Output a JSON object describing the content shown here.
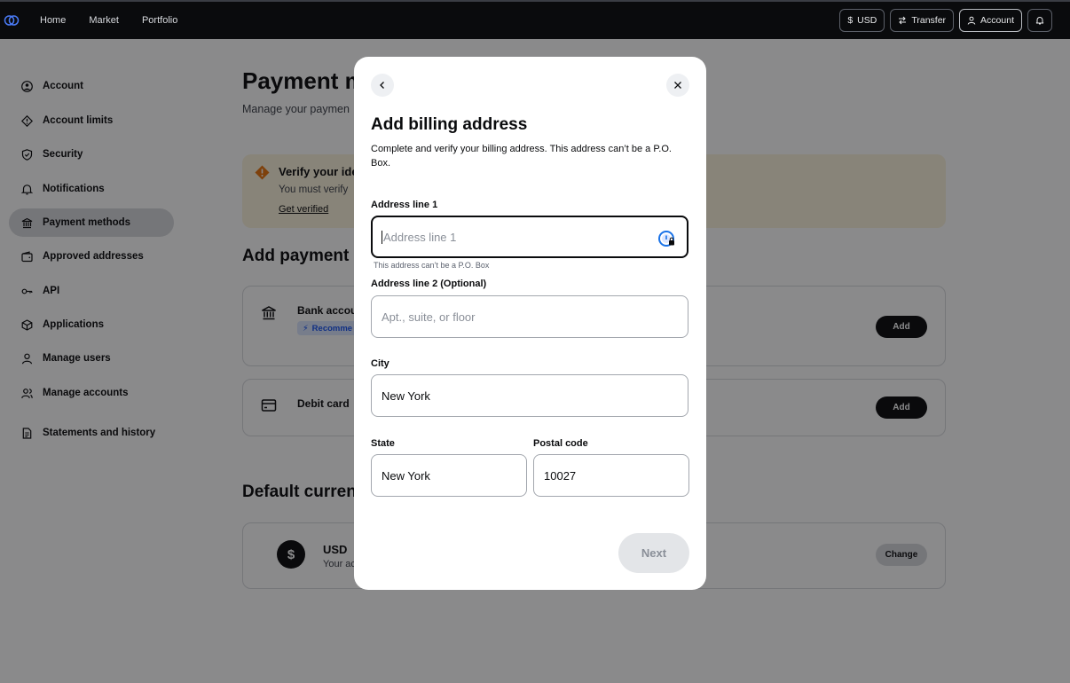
{
  "topbar": {
    "nav": [
      "Home",
      "Market",
      "Portfolio"
    ],
    "currency_label": "USD",
    "transfer_label": "Transfer",
    "account_label": "Account"
  },
  "sidebar": {
    "items": [
      {
        "label": "Account",
        "icon": "user-circle-icon"
      },
      {
        "label": "Account limits",
        "icon": "diamond-alert-icon"
      },
      {
        "label": "Security",
        "icon": "shield-icon"
      },
      {
        "label": "Notifications",
        "icon": "bell-icon"
      },
      {
        "label": "Payment methods",
        "icon": "bank-icon",
        "active": true
      },
      {
        "label": "Approved addresses",
        "icon": "wallet-icon"
      },
      {
        "label": "API",
        "icon": "key-icon"
      },
      {
        "label": "Applications",
        "icon": "cube-icon"
      },
      {
        "label": "Manage users",
        "icon": "user-icon"
      },
      {
        "label": "Manage accounts",
        "icon": "users-icon"
      },
      {
        "label": "Statements and history",
        "icon": "document-icon"
      }
    ]
  },
  "main": {
    "title": "Payment m",
    "subtitle": "Manage your paymen",
    "verify": {
      "title": "Verify your ide",
      "text": "You must verify",
      "link": "Get verified"
    },
    "add_section_title": "Add payment",
    "bank_label": "Bank accoun",
    "bank_badge": "Recomme",
    "debit_label": "Debit card",
    "add_label": "Add",
    "default_section_title": "Default curren",
    "usd_symbol": "$",
    "usd_label": "USD",
    "usd_sub": "Your ac",
    "change_label": "Change"
  },
  "modal": {
    "title": "Add billing address",
    "description": "Complete and verify your billing address. This address can’t be a P.O. Box.",
    "address1_label": "Address line 1",
    "address1_placeholder": "Address line 1",
    "address1_hint": "This address can’t be a P.O. Box",
    "address2_label": "Address line 2 (Optional)",
    "address2_placeholder": "Apt., suite, or floor",
    "city_label": "City",
    "city_value": "New York",
    "state_label": "State",
    "state_value": "New York",
    "postal_label": "Postal code",
    "postal_value": "10027",
    "next_label": "Next"
  },
  "colors": {
    "topbar": "#0a0b0d",
    "overlay": "rgba(10,11,13,0.48)",
    "accent_blue": "#1652f0",
    "warning_orange": "#e8730c"
  }
}
